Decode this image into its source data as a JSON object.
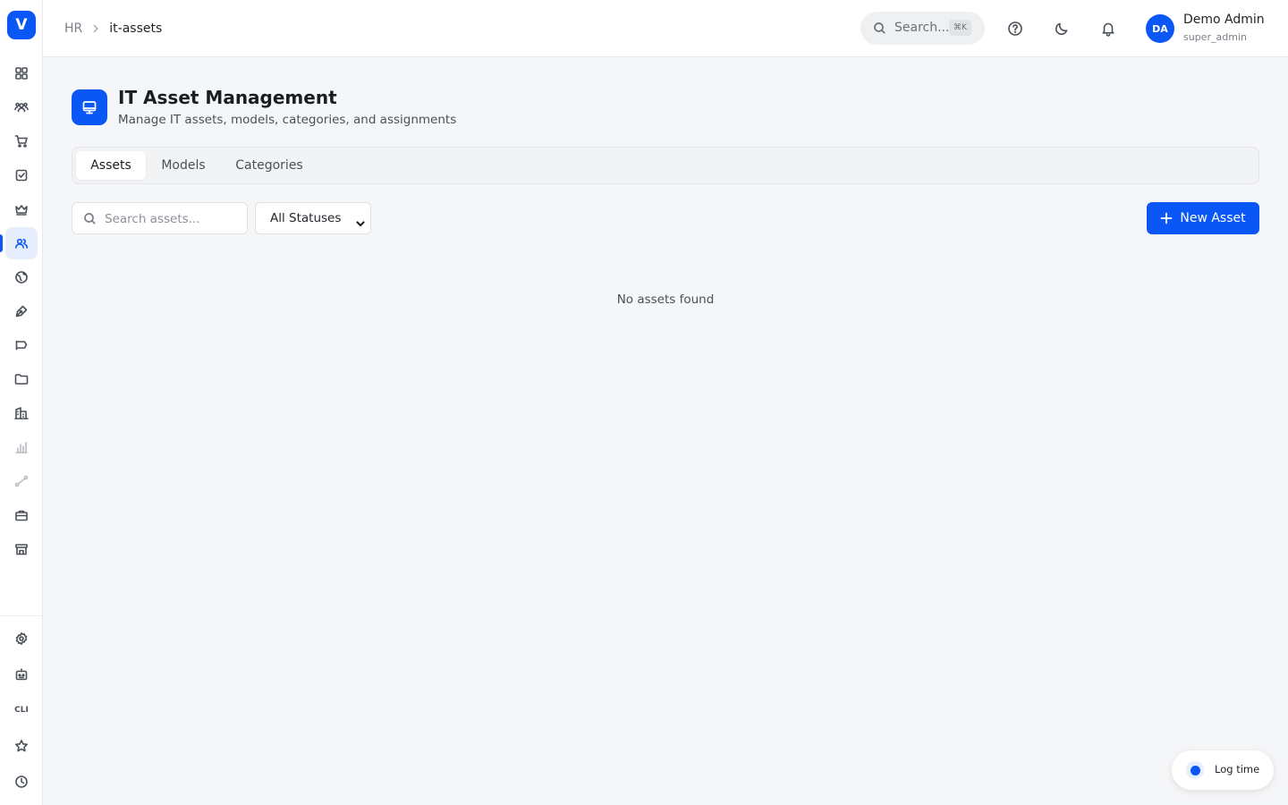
{
  "app": {
    "logo_letter": "V",
    "accent_color": "#0b57f5"
  },
  "sidebar": {
    "items": [
      {
        "name": "dashboard-icon"
      },
      {
        "name": "users-group-icon"
      },
      {
        "name": "cart-icon"
      },
      {
        "name": "checkbox-icon"
      },
      {
        "name": "crown-icon"
      },
      {
        "name": "hr-people-icon",
        "active": true
      },
      {
        "name": "globe-icon"
      },
      {
        "name": "pen-tool-icon"
      },
      {
        "name": "megaphone-icon"
      },
      {
        "name": "folder-icon"
      },
      {
        "name": "building-icon"
      },
      {
        "name": "bar-chart-icon"
      },
      {
        "name": "workflow-icon"
      },
      {
        "name": "briefcase-icon"
      },
      {
        "name": "store-icon"
      }
    ],
    "bottom_items": [
      {
        "name": "settings-icon"
      },
      {
        "name": "bot-icon"
      },
      {
        "name": "cli-icon",
        "label": "CLI"
      },
      {
        "name": "star-icon"
      },
      {
        "name": "clock-icon"
      }
    ]
  },
  "header": {
    "breadcrumb": [
      "HR",
      "it-assets"
    ],
    "search_placeholder": "Search...",
    "search_shortcut": "⌘K",
    "user": {
      "initials": "DA",
      "name": "Demo Admin",
      "role": "super_admin"
    }
  },
  "main": {
    "title": "IT Asset Management",
    "subtitle": "Manage IT assets, models, categories, and assignments",
    "tabs": [
      {
        "label": "Assets",
        "active": true
      },
      {
        "label": "Models",
        "active": false
      },
      {
        "label": "Categories",
        "active": false
      }
    ],
    "search_placeholder": "Search assets...",
    "status_filter": "All Statuses",
    "new_button_label": "New Asset",
    "empty_message": "No assets found"
  },
  "log_time": {
    "label": "Log time"
  }
}
